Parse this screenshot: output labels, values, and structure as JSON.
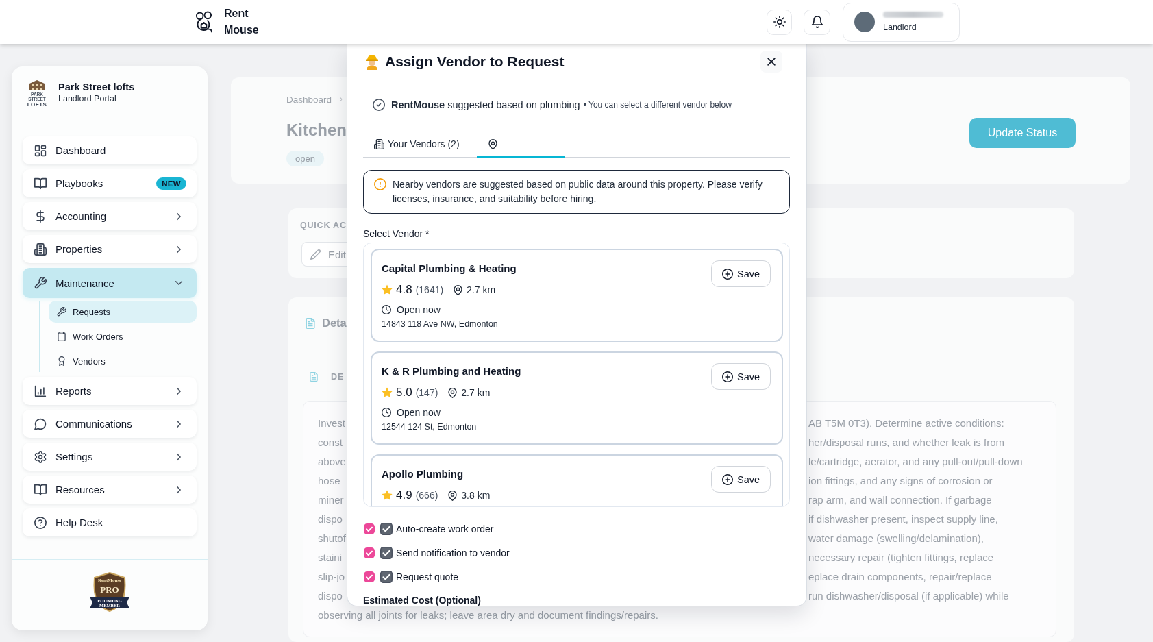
{
  "header": {
    "brand": "Rent Mouse",
    "user_role": "Landlord"
  },
  "sidebar": {
    "property": {
      "logo_lines": [
        "PARK STREET",
        "LOFTS"
      ],
      "name": "Park Street lofts",
      "subtitle": "Landlord Portal"
    },
    "nav": [
      {
        "label": "Dashboard",
        "kind": "link",
        "selected": false,
        "expanded": false
      },
      {
        "label": "Playbooks",
        "kind": "link",
        "badge": "NEW",
        "selected": false,
        "expanded": false
      },
      {
        "label": "Accounting",
        "kind": "group",
        "selected": false,
        "expanded": false
      },
      {
        "label": "Properties",
        "kind": "group",
        "selected": false,
        "expanded": false
      },
      {
        "label": "Maintenance",
        "kind": "group",
        "selected": true,
        "expanded": true,
        "children": [
          {
            "label": "Requests",
            "selected": true
          },
          {
            "label": "Work Orders",
            "selected": false
          },
          {
            "label": "Vendors",
            "selected": false
          }
        ]
      },
      {
        "label": "Reports",
        "kind": "group",
        "selected": false,
        "expanded": false
      },
      {
        "label": "Communications",
        "kind": "group",
        "selected": false,
        "expanded": false
      },
      {
        "label": "Settings",
        "kind": "group",
        "selected": false,
        "expanded": false
      },
      {
        "label": "Resources",
        "kind": "group",
        "selected": false,
        "expanded": false
      },
      {
        "label": "Help Desk",
        "kind": "link",
        "selected": false,
        "expanded": false
      }
    ],
    "badge_lines": [
      "RentMouse",
      "PRO",
      "FOUNDING",
      "MEMBER"
    ]
  },
  "page": {
    "breadcrumb": [
      "Dashboard"
    ],
    "title": "Kitchen",
    "tags": [
      {
        "label": "open",
        "kind": "pill"
      }
    ],
    "primary_button": "Update Status",
    "quick_actions": {
      "heading": "QUICK AC",
      "buttons": [
        {
          "kind": "outline",
          "label": "Edit"
        }
      ]
    },
    "details": {
      "heading": "Deta",
      "section": "DE",
      "lines": [
        {
          "kind": "edges",
          "left": "Invest",
          "right": "AB T5M 0T3). Determine active conditions:"
        },
        {
          "kind": "edges",
          "left": "const",
          "right": "her/disposal runs, and whether leak is from"
        },
        {
          "kind": "edges",
          "left": "above",
          "right": "le/cartridge, aerator, and any pull-out/pull-down"
        },
        {
          "kind": "edges",
          "left": "hose",
          "right": "ion fittings, and any signs of corrosion or"
        },
        {
          "kind": "edges",
          "left": "miner",
          "right": "rap arm, and wall connection. If garbage"
        },
        {
          "kind": "edges",
          "left": "dispo",
          "right": "if dishwasher present, inspect supply line,"
        },
        {
          "kind": "edges",
          "left": "shutof",
          "right": "water damage (swelling/delamination),"
        },
        {
          "kind": "edges",
          "left": "staini",
          "right": "necessary repair (tighten fittings, replace"
        },
        {
          "kind": "edges",
          "left": "slip-jo",
          "right": "eplace drain components, repair/replace"
        },
        {
          "kind": "edges",
          "left": "dispo",
          "right": "run dishwasher/disposal (if applicable) while"
        },
        {
          "kind": "full",
          "text": "observing all joints for leaks; leave area dry and document findings/repairs."
        }
      ]
    }
  },
  "modal": {
    "title": "Assign Vendor to Request",
    "suggestion": "**RentMouse** suggested based on plumbing",
    "suggestion_note": "• You can select a different vendor below",
    "tabs": [
      {
        "label": "Your Vendors (2)",
        "selected": false
      },
      {
        "selected": true
      }
    ],
    "notice": "Nearby vendors are suggested based on public data around this property. Please verify licenses, insurance, and suitability before hiring.",
    "vendor_label": "Select Vendor *",
    "vendors": [
      {
        "name": "Capital Plumbing & Heating",
        "rating": "4.8",
        "reviews": "(1641)",
        "distance": "2.7 km",
        "hours": "Open now",
        "address": "14843 118 Ave NW, Edmonton",
        "action": "Save"
      },
      {
        "name": "K & R Plumbing and Heating",
        "rating": "5.0",
        "reviews": "(147)",
        "distance": "2.7 km",
        "hours": "Open now",
        "address": "12544 124 St, Edmonton",
        "action": "Save"
      },
      {
        "name": "Apollo Plumbing",
        "rating": "4.9",
        "reviews": "(666)",
        "distance": "3.8 km",
        "action": "Save"
      }
    ],
    "options": [
      {
        "label": "Auto-create work order",
        "checked": true
      },
      {
        "label": "Send notification to vendor",
        "checked": true
      },
      {
        "label": "Request quote",
        "checked": true
      }
    ],
    "cost_label": "Estimated Cost (Optional)"
  }
}
